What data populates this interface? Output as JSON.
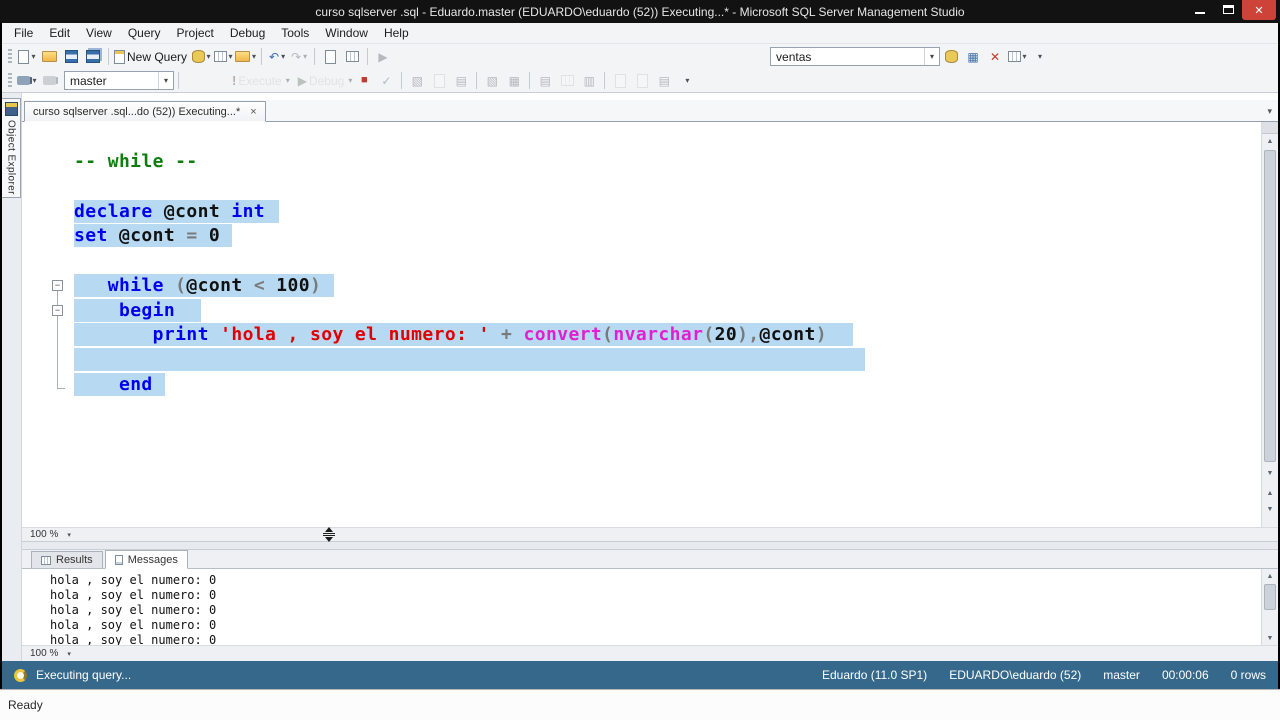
{
  "window": {
    "title": "curso sqlserver .sql - Eduardo.master (EDUARDO\\eduardo (52)) Executing...* - Microsoft SQL Server Management Studio"
  },
  "menu": {
    "items": [
      "File",
      "Edit",
      "View",
      "Query",
      "Project",
      "Debug",
      "Tools",
      "Window",
      "Help"
    ]
  },
  "toolbar": {
    "new_query_label": "New Query",
    "database_combo": "ventas"
  },
  "sql_toolbar": {
    "connection_combo": "master",
    "execute_label": "Execute",
    "debug_label": "Debug"
  },
  "tab": {
    "title": "curso sqlserver .sql...do (52)) Executing...*"
  },
  "object_explorer": {
    "label": "Object Explorer"
  },
  "editor": {
    "zoom_label": "100 %",
    "code": [
      {
        "sel": false,
        "tokens": [
          [
            "-- while --",
            "com"
          ]
        ]
      },
      {
        "sel": false,
        "tokens": []
      },
      {
        "sel": true,
        "selEnd": 277,
        "tokens": [
          [
            "declare ",
            "kw"
          ],
          [
            "@cont ",
            "id"
          ],
          [
            "int",
            "kw"
          ]
        ]
      },
      {
        "sel": true,
        "selEnd": 230,
        "tokens": [
          [
            "set ",
            "kw"
          ],
          [
            "@cont ",
            "id"
          ],
          [
            "= ",
            "op"
          ],
          [
            "0",
            "num"
          ]
        ]
      },
      {
        "sel": false,
        "tokens": []
      },
      {
        "sel": true,
        "selEnd": 332,
        "tokens": [
          [
            "   ",
            "pl"
          ],
          [
            "while ",
            "kw"
          ],
          [
            "(",
            "op"
          ],
          [
            "@cont ",
            "id"
          ],
          [
            "< ",
            "op"
          ],
          [
            "100",
            "num"
          ],
          [
            ")",
            "op"
          ]
        ]
      },
      {
        "sel": true,
        "selEnd": 199,
        "tokens": [
          [
            "    ",
            "pl"
          ],
          [
            "begin",
            "kw"
          ]
        ]
      },
      {
        "sel": true,
        "selEnd": 851,
        "tokens": [
          [
            "       ",
            "pl"
          ],
          [
            "print ",
            "kw"
          ],
          [
            "'hola , soy el numero: '",
            "str"
          ],
          [
            " + ",
            "op"
          ],
          [
            "convert",
            "fn"
          ],
          [
            "(",
            "op"
          ],
          [
            "nvarchar",
            "fn"
          ],
          [
            "(",
            "op"
          ],
          [
            "20",
            "num"
          ],
          [
            "),",
            "op"
          ],
          [
            "@cont",
            "id"
          ],
          [
            ")",
            "op"
          ]
        ]
      },
      {
        "sel": true,
        "selEnd": 863,
        "tokens": []
      },
      {
        "sel": true,
        "selEnd": 163,
        "tokens": [
          [
            "    ",
            "pl"
          ],
          [
            "end",
            "kw"
          ]
        ]
      }
    ]
  },
  "results": {
    "tab_results": "Results",
    "tab_messages": "Messages",
    "zoom_label": "100 %",
    "messages": [
      "hola , soy el numero: 0",
      "hola , soy el numero: 0",
      "hola , soy el numero: 0",
      "hola , soy el numero: 0",
      "hola , soy el numero: 0"
    ]
  },
  "statusbar": {
    "status": "Executing query...",
    "server": "Eduardo (11.0 SP1)",
    "user": "EDUARDO\\eduardo (52)",
    "database": "master",
    "time": "00:00:06",
    "rows": "0 rows"
  },
  "taskbar": {
    "ready": "Ready"
  },
  "icons": {
    "dropdown": "▾",
    "close_window": "✕",
    "close_tab": "×",
    "undo": "↶",
    "redo": "↷",
    "play": "▶",
    "stop": "■",
    "check": "✓",
    "cancel": "✕",
    "exclamation": "!",
    "up": "▲",
    "down": "▼",
    "minus": "−",
    "sq1": "▤",
    "sq2": "▦",
    "sq3": "▥",
    "sq4": "▧"
  }
}
